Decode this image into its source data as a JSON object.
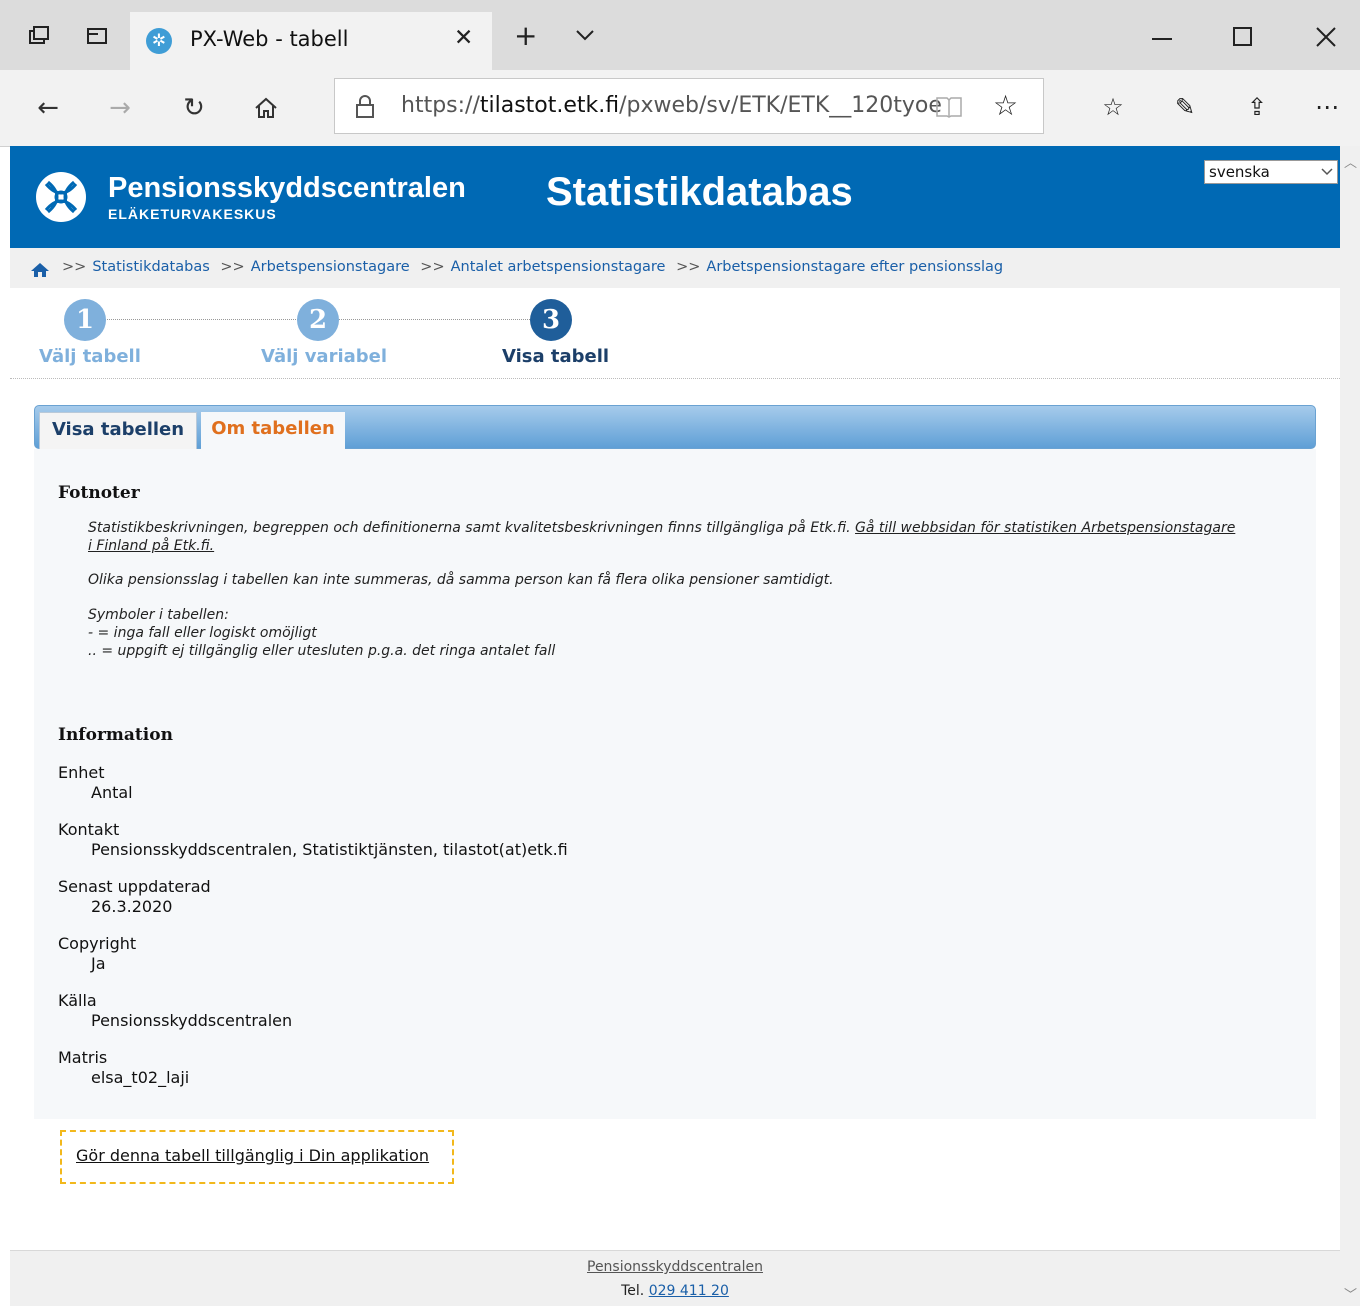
{
  "browser": {
    "tab_title": "PX-Web - tabell",
    "url_prefix": "https://",
    "url_host": "tilastot.etk.fi",
    "url_path": "/pxweb/sv/ETK/ETK__120tyoe"
  },
  "header": {
    "org_name": "Pensionsskyddscentralen",
    "org_subtitle": "ELÄKETURVAKESKUS",
    "site_title": "Statistikdatabas",
    "language": "svenska",
    "brand_color": "#0069b4"
  },
  "breadcrumb": {
    "separator": ">>",
    "items": [
      "Statistikdatabas",
      "Arbetspensionstagare",
      "Antalet arbetspensionstagare",
      "Arbetspensionstagare efter pensionsslag"
    ]
  },
  "steps": [
    {
      "number": "1",
      "label": "Välj tabell"
    },
    {
      "number": "2",
      "label": "Välj variabel"
    },
    {
      "number": "3",
      "label": "Visa tabell"
    }
  ],
  "tabs": {
    "show_table": "Visa tabellen",
    "about_table": "Om tabellen"
  },
  "footnotes": {
    "heading": "Fotnoter",
    "note1_text": "Statistikbeskrivningen, begreppen och definitionerna samt kvalitetsbeskrivningen finns tillgängliga på Etk.fi. ",
    "note1_link": "Gå till webbsidan för statistiken Arbetspensionstagare i Finland på Etk.fi.",
    "note2": "Olika pensionsslag i tabellen kan inte summeras, då samma person kan få flera olika pensioner samtidigt.",
    "symbols_title": "Symboler i tabellen:",
    "symbol1": "- = inga fall eller logiskt omöjligt",
    "symbol2": ".. = uppgift ej tillgänglig eller utesluten p.g.a. det ringa antalet fall"
  },
  "information": {
    "heading": "Information",
    "fields": [
      {
        "label": "Enhet",
        "value": "Antal"
      },
      {
        "label": "Kontakt",
        "value": "Pensionsskyddscentralen, Statistiktjänsten, tilastot(at)etk.fi"
      },
      {
        "label": "Senast uppdaterad",
        "value": "26.3.2020"
      },
      {
        "label": "Copyright",
        "value": "Ja"
      },
      {
        "label": "Källa",
        "value": "Pensionsskyddscentralen"
      },
      {
        "label": "Matris",
        "value": "elsa_t02_laji"
      }
    ]
  },
  "app_link": "Gör denna tabell tillgänglig i Din applikation",
  "footer": {
    "org": "Pensionsskyddscentralen",
    "tel_label": "Tel. ",
    "tel_number": "029 411 20"
  }
}
